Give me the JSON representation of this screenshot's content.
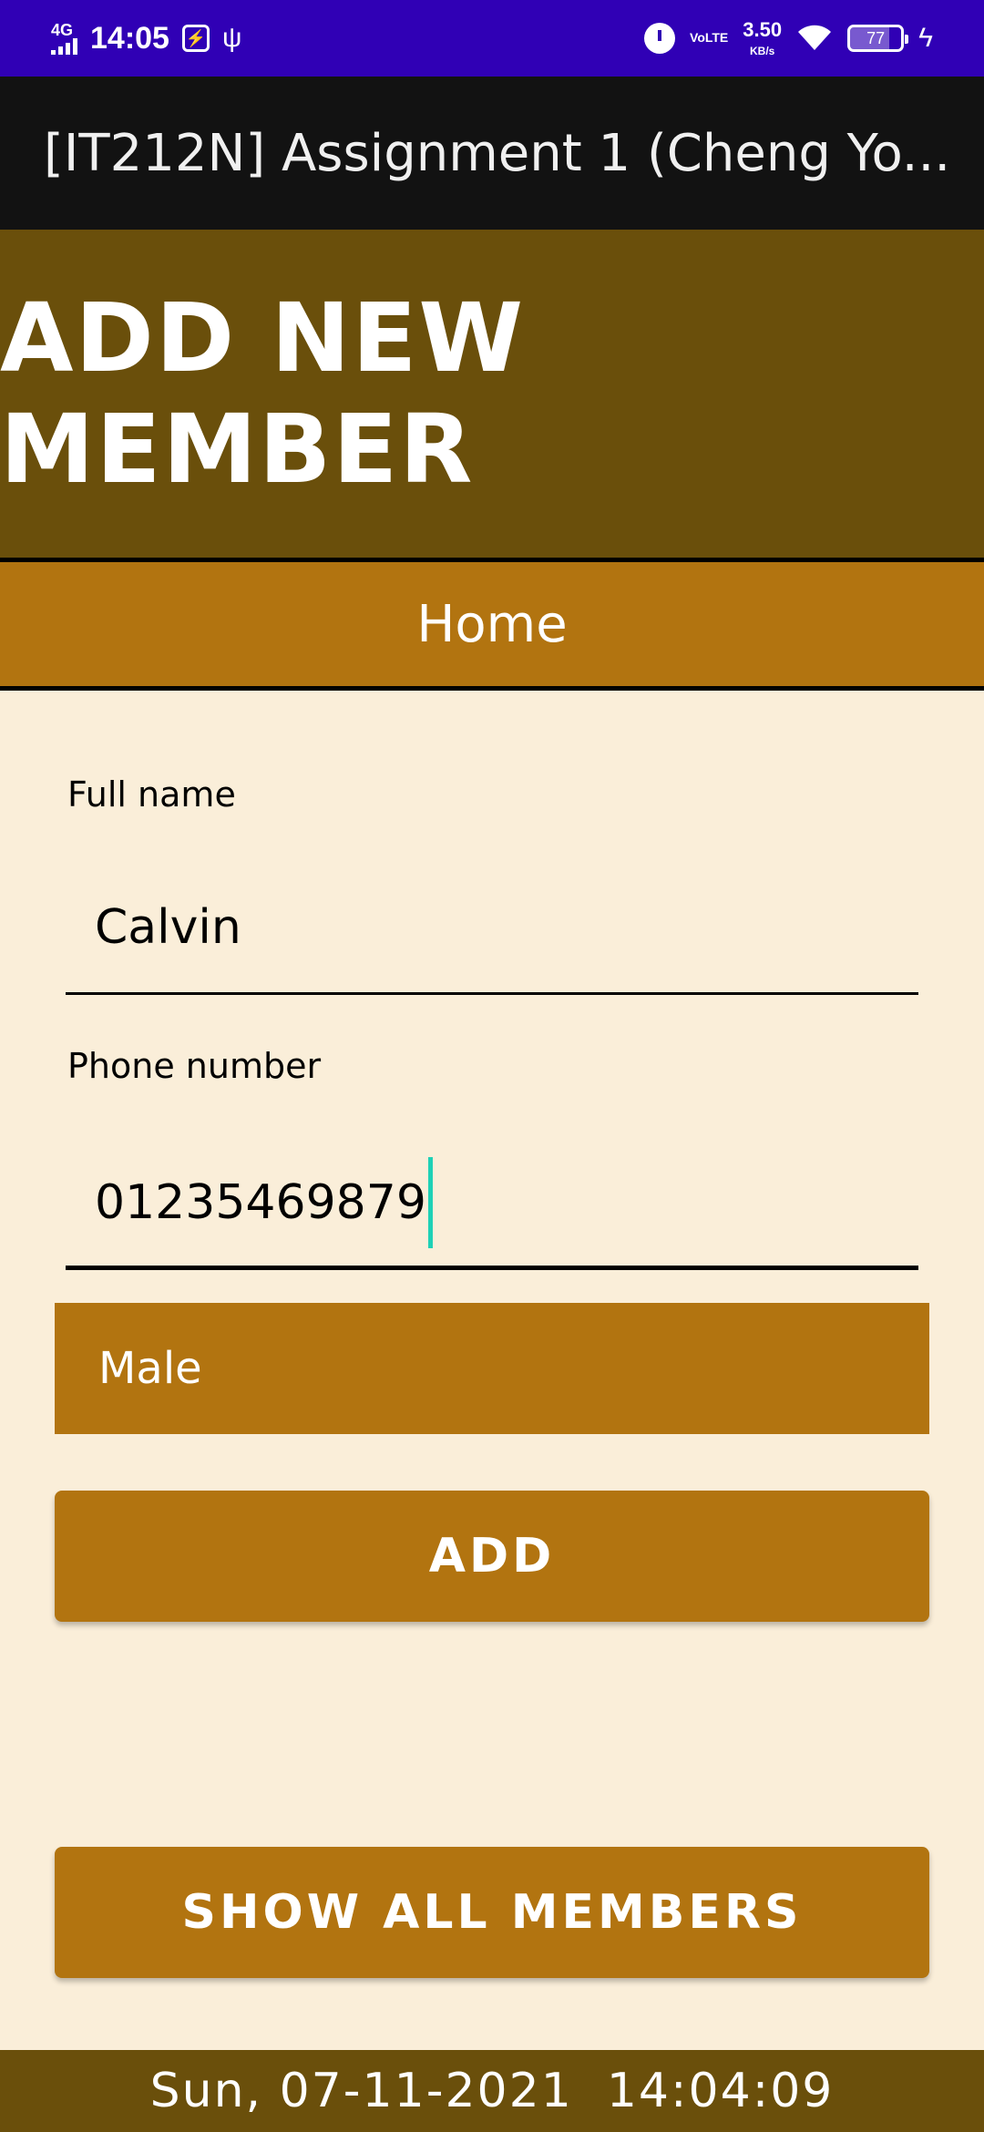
{
  "status_bar": {
    "network": "4G",
    "time": "14:05",
    "speed": "3.50",
    "speed_unit": "KB/s",
    "volte": "VoLTE",
    "battery": "77",
    "battery_level": 0.77
  },
  "app_bar": {
    "title": "[IT212N] Assignment 1 (Cheng Yo..."
  },
  "header": {
    "title": "ADD NEW MEMBER"
  },
  "nav": {
    "home_label": "Home"
  },
  "form": {
    "full_name_label": "Full name",
    "full_name_value": "Calvin",
    "phone_label": "Phone number",
    "phone_value": "01235469879",
    "gender_selected": "Male",
    "add_button": "ADD"
  },
  "show_all_button": "SHOW ALL MEMBERS",
  "footer": {
    "datetime": "Sun, 07-11-2021  14:04:09"
  },
  "colors": {
    "status_bar": "#3000b5",
    "app_bar": "#121212",
    "header": "#6a4f0b",
    "accent": "#b27410",
    "background": "#faeed9",
    "cursor": "#1ed1b6"
  }
}
